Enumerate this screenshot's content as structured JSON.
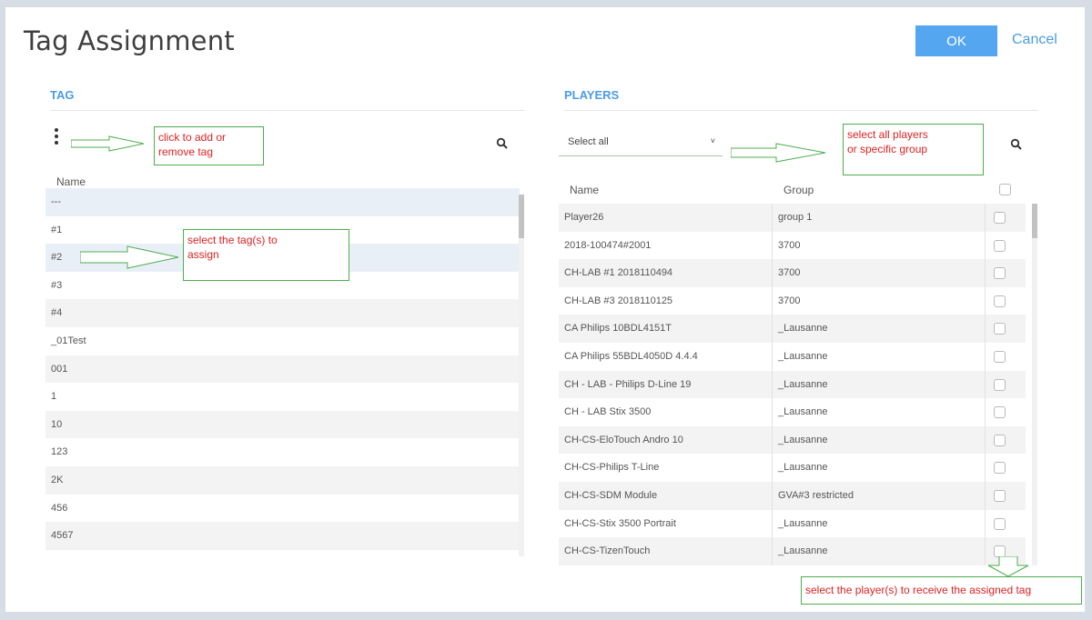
{
  "dialog": {
    "title": "Tag Assignment",
    "ok_label": "OK",
    "cancel_label": "Cancel"
  },
  "tag_panel": {
    "title": "TAG",
    "column_name": "Name",
    "rows": [
      "---",
      "#1",
      "#2",
      "#3",
      "#4",
      "_01Test",
      "001",
      "1",
      "10",
      "123",
      "2K",
      "456",
      "4567"
    ]
  },
  "players_panel": {
    "title": "PLAYERS",
    "select_value": "Select all",
    "column_name": "Name",
    "column_group": "Group",
    "rows": [
      {
        "name": "Player26",
        "group": "group 1"
      },
      {
        "name": "2018-100474#2001",
        "group": "3700"
      },
      {
        "name": "CH-LAB #1 2018110494",
        "group": "3700"
      },
      {
        "name": "CH-LAB #3 2018110125",
        "group": "3700"
      },
      {
        "name": "CA Philips 10BDL4151T",
        "group": "_Lausanne"
      },
      {
        "name": "CA Philips 55BDL4050D 4.4.4",
        "group": "_Lausanne"
      },
      {
        "name": "CH - LAB - Philips D-Line 19",
        "group": "_Lausanne"
      },
      {
        "name": "CH - LAB Stix 3500",
        "group": "_Lausanne"
      },
      {
        "name": "CH-CS-EloTouch Andro 10",
        "group": "_Lausanne"
      },
      {
        "name": "CH-CS-Philips T-Line",
        "group": "_Lausanne"
      },
      {
        "name": "CH-CS-SDM Module",
        "group": "GVA#3 restricted"
      },
      {
        "name": "CH-CS-Stix 3500 Portrait",
        "group": "_Lausanne"
      },
      {
        "name": "CH-CS-TizenTouch",
        "group": "_Lausanne"
      }
    ]
  },
  "annotations": {
    "add_remove_tag": [
      "click to add or",
      "remove tag"
    ],
    "select_tags": [
      "select the tag(s) to",
      "assign"
    ],
    "select_players_group": [
      "select all players",
      "or specific group"
    ],
    "select_players_receive": "select the player(s) to receive the assigned tag"
  },
  "icons": [
    "more-vertical-icon",
    "search-icon",
    "chevron-down-icon",
    "arrow-right-icon",
    "arrow-down-icon"
  ],
  "colors": {
    "accent": "#4b9be6",
    "ok_button": "#54a6f0",
    "annotation_border": "#4cae4c",
    "annotation_text": "#dd2222"
  }
}
